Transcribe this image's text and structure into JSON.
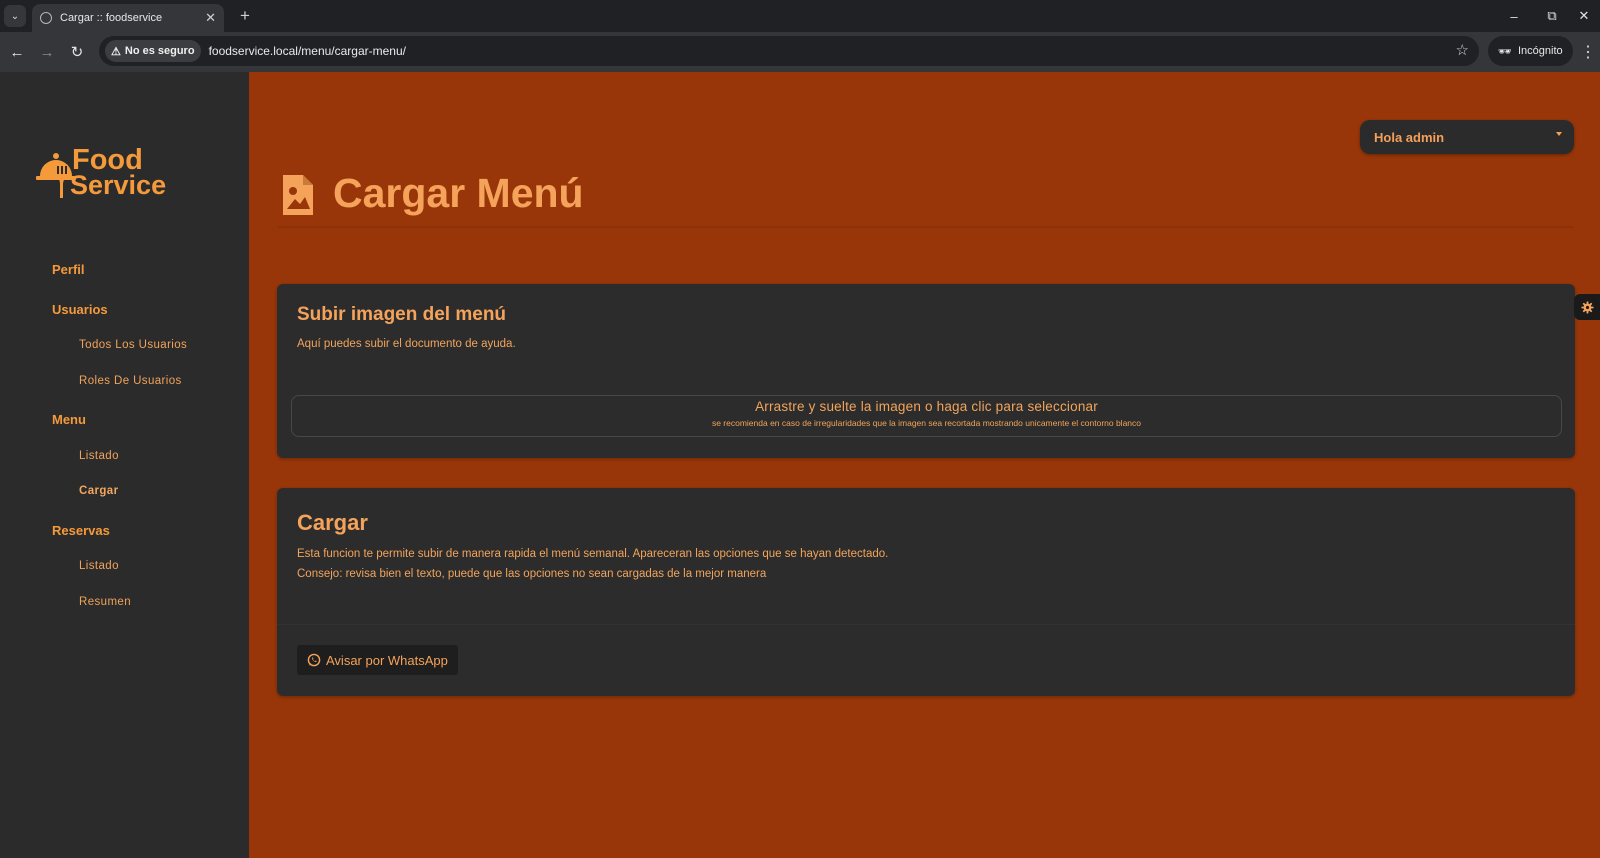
{
  "browser": {
    "tab_title": "Cargar :: foodservice",
    "security_label": "No es seguro",
    "url": "foodservice.local/menu/cargar-menu/",
    "incognito_label": "Incógnito"
  },
  "logo": {
    "line1": "Food",
    "line2": "Service"
  },
  "sidebar": {
    "perfil": "Perfil",
    "usuarios": "Usuarios",
    "todos_usuarios": "Todos Los Usuarios",
    "roles_usuarios": "Roles De Usuarios",
    "menu": "Menu",
    "menu_listado": "Listado",
    "menu_cargar": "Cargar",
    "reservas": "Reservas",
    "reservas_listado": "Listado",
    "reservas_resumen": "Resumen"
  },
  "header": {
    "user_menu": "Hola admin",
    "page_title": "Cargar Menú"
  },
  "upload_card": {
    "title": "Subir imagen del menú",
    "description": "Aquí puedes subir el documento de ayuda.",
    "dropzone_text": "Arrastre y suelte la imagen o haga clic para seleccionar",
    "dropzone_hint": "se recomienda en caso de irregularidades que la imagen sea recortada mostrando unicamente el contorno blanco"
  },
  "load_card": {
    "title": "Cargar",
    "line1": "Esta funcion te permite subir de manera rapida el menú semanal. Apareceran las opciones que se hayan detectado.",
    "line2": "Consejo: revisa bien el texto, puede que las opciones no sean cargadas de la mejor manera",
    "whatsapp_button": "Avisar por WhatsApp"
  },
  "colors": {
    "accent": "#f5a35a",
    "background": "#983609",
    "panel": "#2c2c2c"
  }
}
